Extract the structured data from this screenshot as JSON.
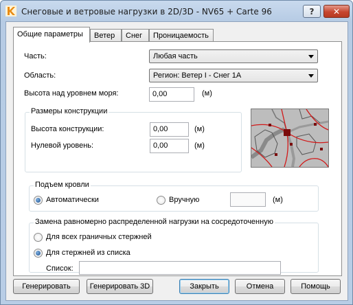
{
  "window": {
    "title": "Снеговые и ветровые нагрузки в 2D/3D - NV65 + Carte 96",
    "help_label": "?",
    "close_label": "✕"
  },
  "tabs": [
    {
      "label": "Общие параметры",
      "active": true
    },
    {
      "label": "Ветер",
      "active": false
    },
    {
      "label": "Снег",
      "active": false
    },
    {
      "label": "Проницаемость",
      "active": false
    }
  ],
  "general": {
    "part_label": "Часть:",
    "part_value": "Любая часть",
    "area_label": "Область:",
    "area_value": "Регион: Ветер I - Снег 1А",
    "altitude_label": "Высота над уровнем моря:",
    "altitude_value": "0,00",
    "altitude_unit": "(м)"
  },
  "dimensions": {
    "caption": "Размеры конструкции",
    "height_label": "Высота конструкции:",
    "height_value": "0,00",
    "height_unit": "(м)",
    "zero_label": "Нулевой уровень:",
    "zero_value": "0,00",
    "zero_unit": "(м)"
  },
  "roof": {
    "caption": "Подъем кровли",
    "auto_label": "Автоматически",
    "auto_checked": true,
    "manual_label": "Вручную",
    "manual_checked": false,
    "manual_value": "",
    "unit": "(м)"
  },
  "replacement": {
    "caption": "Замена равномерно распределенной нагрузки на сосредоточенную",
    "option_all_label": "Для всех граничных стержней",
    "option_all_checked": false,
    "option_list_label": "Для стержней из списка",
    "option_list_checked": true,
    "list_label": "Список:",
    "list_value": ""
  },
  "buttons": {
    "generate": "Генерировать",
    "generate_3d": "Генерировать 3D",
    "close": "Закрыть",
    "cancel": "Отмена",
    "help": "Помощь"
  },
  "map": {
    "background_color": "#bdbdbd",
    "border_line_color": "#d21818",
    "road_color": "#8a8a8a"
  }
}
